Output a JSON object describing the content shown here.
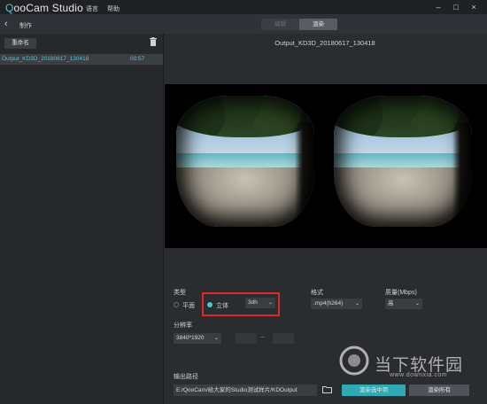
{
  "app": {
    "logo_prefix": "Q",
    "logo_rest": "ooCam Studio",
    "menu": [
      "语言",
      "帮助"
    ],
    "window_buttons": [
      "–",
      "□",
      "×"
    ]
  },
  "subbar": {
    "breadcrumb": "制作",
    "tabs": [
      {
        "label": "编辑",
        "active": false
      },
      {
        "label": "渲染",
        "active": true
      }
    ]
  },
  "sidebar": {
    "rename_label": "重命名",
    "items": [
      {
        "name": "Output_KD3D_20180617_130418",
        "duration": "00:57"
      }
    ]
  },
  "main": {
    "file_title": "Output_KD3D_20180617_130418"
  },
  "settings": {
    "type_label": "类型",
    "type_options": [
      {
        "label": "平面",
        "selected": false
      },
      {
        "label": "立体",
        "selected": true
      }
    ],
    "stereo_mode": "3dh",
    "format_label": "格式",
    "format_value": ".mp4(h264)",
    "quality_label": "质量(Mbps)",
    "quality_value": "高",
    "resolution_label": "分辨率",
    "resolution_value": "3840*1920",
    "output_label": "输出路径",
    "output_path": "E:/QooCam/给大家的Studio测试样片/KDOutput",
    "render_selected_label": "渲染选中项",
    "render_all_label": "渲染所有"
  },
  "watermark": {
    "text": "当下软件园",
    "url": "www.downxia.com"
  },
  "colors": {
    "accent": "#4bc9d5",
    "highlight_box": "#e3262a",
    "primary_button": "#2fa9b4"
  }
}
